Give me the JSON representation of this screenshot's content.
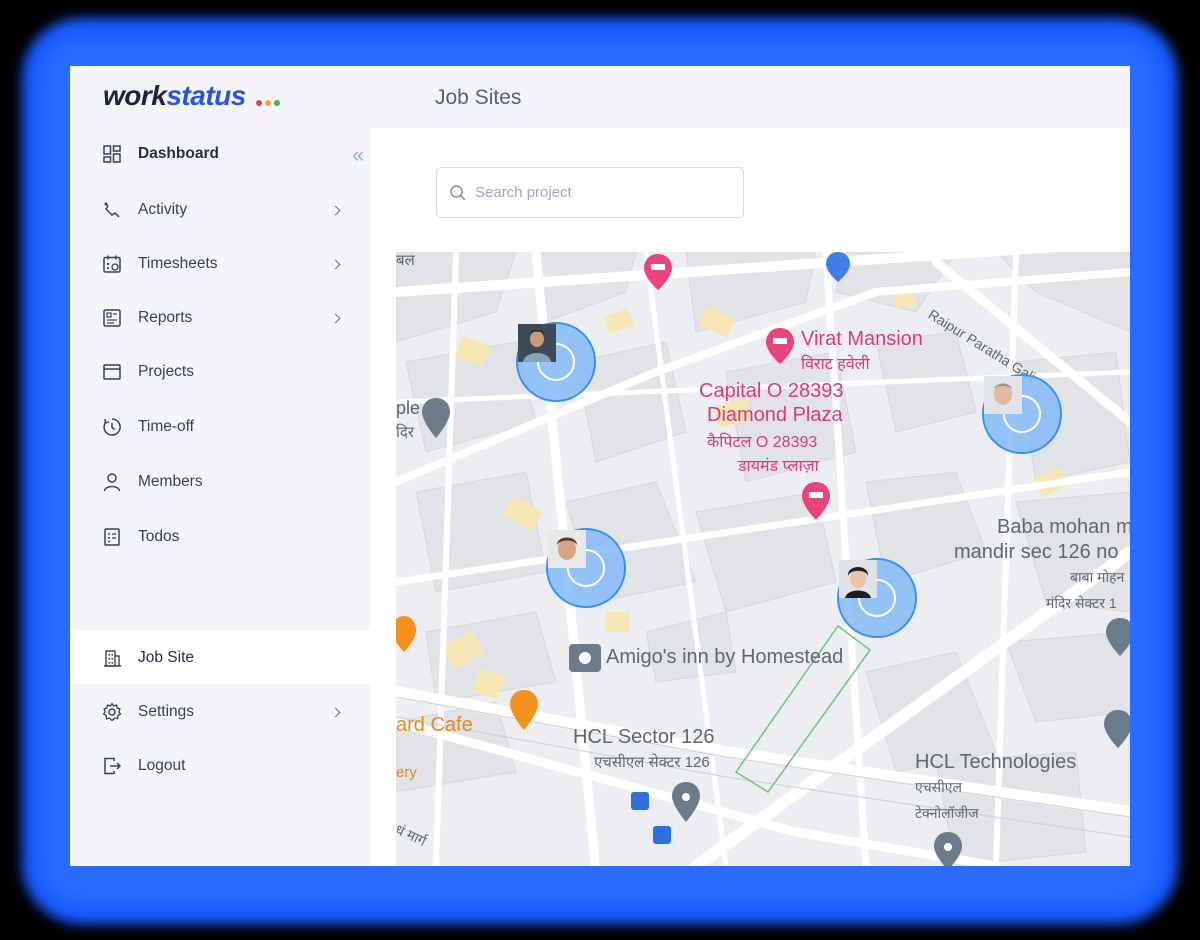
{
  "app": {
    "logo_part1": "work",
    "logo_part2": "status",
    "logo_dot_colors": [
      "#e64545",
      "#f2a93b",
      "#3cb35b"
    ]
  },
  "header": {
    "title": "Job Sites"
  },
  "sidebar": {
    "items": [
      {
        "label": "Dashboard",
        "icon": "dashboard-icon",
        "has_arrow": false
      },
      {
        "label": "Activity",
        "icon": "activity-icon",
        "has_arrow": true
      },
      {
        "label": "Timesheets",
        "icon": "calendar-icon",
        "has_arrow": true
      },
      {
        "label": "Reports",
        "icon": "reports-icon",
        "has_arrow": true
      },
      {
        "label": "Projects",
        "icon": "projects-icon",
        "has_arrow": false
      },
      {
        "label": "Time-off",
        "icon": "timer-icon",
        "has_arrow": false
      },
      {
        "label": "Members",
        "icon": "user-icon",
        "has_arrow": false
      },
      {
        "label": "Todos",
        "icon": "checklist-icon",
        "has_arrow": false
      },
      {
        "label": "Job Site",
        "icon": "building-icon",
        "has_arrow": false,
        "active": true
      },
      {
        "label": "Settings",
        "icon": "gear-icon",
        "has_arrow": true
      },
      {
        "label": "Logout",
        "icon": "logout-icon",
        "has_arrow": false
      }
    ]
  },
  "search": {
    "placeholder": "Search project"
  },
  "map": {
    "labels": {
      "virat_en": "Virat Mansion",
      "virat_hi": "विराट हवेली",
      "capital_en1": "Capital O 28393",
      "capital_en2": "Diamond Plaza",
      "capital_hi1": "कैपिटल O 28393",
      "capital_hi2": "डायमंड प्लाज़ा",
      "raipur": "Raipur Paratha Gali",
      "baba_en1": "Baba mohan m",
      "baba_en2": "mandir sec 126 no",
      "baba_hi1": "बाबा मोहन",
      "baba_hi2": "मंदिर सेक्टर 1",
      "amigo": "Amigo's inn by Homestead",
      "hcl126_en": "HCL Sector 126",
      "hcl126_hi": "एचसीएल सेक्टर 126",
      "hcltech_en": "HCL Technologies",
      "hcltech_hi1": "एचसीएल",
      "hcltech_hi2": "टेक्नोलॉजीज",
      "cafe": "ard Cafe",
      "ery": "ery",
      "ple": "ple",
      "dir": "दिर",
      "bal": "बल",
      "marg": "धं मार्ग"
    },
    "colors": {
      "pink": "#d83a7d",
      "marker_fill": "#84baf6",
      "marker_border": "#3a8ff0",
      "accent": "#2b55d9"
    }
  }
}
